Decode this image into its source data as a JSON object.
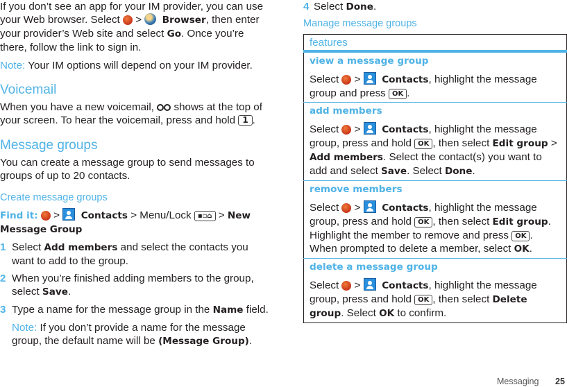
{
  "left": {
    "intro": {
      "t1": "If you don’t see an app for your IM provider, you can use your Web browser. Select ",
      "t2": " > ",
      "browser": "Browser",
      "t3": ", then enter your provider’s Web site and select ",
      "go": "Go",
      "t4": ". Once you’re there, follow the link to sign in."
    },
    "note1": {
      "label": "Note:",
      "text": " Your IM options will depend on your IM provider."
    },
    "voicemail": {
      "title": "Voicemail",
      "t1": "When you have a new voicemail, ",
      "t2": " shows at the top of your screen. To hear the voicemail, press and hold ",
      "key": "1",
      "t3": "."
    },
    "groups": {
      "title": "Message groups",
      "text": "You can create a message group to send messages to groups of up to 20 contacts."
    },
    "create": {
      "title": "Create message groups",
      "findit": "Find it:",
      "gt": " > ",
      "contacts": "Contacts",
      "menu": " > Menu/Lock ",
      "gt2": " > ",
      "newgroup": "New Message Group",
      "steps": [
        {
          "num": "1",
          "t1": "Select ",
          "b1": "Add members",
          "t2": " and select the contacts you want to add to the group."
        },
        {
          "num": "2",
          "t1": "When you’re finished adding members to the group, select ",
          "b1": "Save",
          "t2": "."
        },
        {
          "num": "3",
          "t1": "Type a name for the message group in the ",
          "b1": "Name",
          "t2": " field."
        }
      ],
      "note": {
        "label": "Note:",
        "t1": " If you don’t provide a name for the message group, the default name will be ",
        "b1": "(Message Group)",
        "t2": "."
      }
    }
  },
  "right": {
    "step4": {
      "num": "4",
      "t1": "Select ",
      "b1": "Done",
      "t2": "."
    },
    "manage_title": "Manage message groups",
    "table": {
      "header": "features",
      "select": "Select ",
      "gt": " > ",
      "contacts": "Contacts",
      "ok": "OK",
      "rows": [
        {
          "title": "view a message group",
          "t1": ", highlight the message group and press ",
          "t2": "."
        },
        {
          "title": "add members",
          "t1": ", highlight the message group, press and hold ",
          "t2": ", then select ",
          "b1": "Edit group",
          "t3": " > ",
          "b2": "Add members",
          "t4": ". Select the contact(s) you want to add and select ",
          "b3": "Save",
          "t5": ". Select ",
          "b4": "Done",
          "t6": "."
        },
        {
          "title": "remove members",
          "t1": ", highlight the message group, press and hold ",
          "t2": ", then select ",
          "b1": "Edit group",
          "t3": ". Highlight the member to remove and press ",
          "t4": ". When prompted to delete a member, select ",
          "b2": "OK",
          "t5": "."
        },
        {
          "title": "delete a message group",
          "t1": ", highlight the message group, press and hold ",
          "t2": ", then select ",
          "b1": "Delete group",
          "t3": ". Select ",
          "b2": "OK",
          "t4": " to confirm."
        }
      ]
    }
  },
  "footer": {
    "section": "Messaging",
    "page": "25"
  }
}
